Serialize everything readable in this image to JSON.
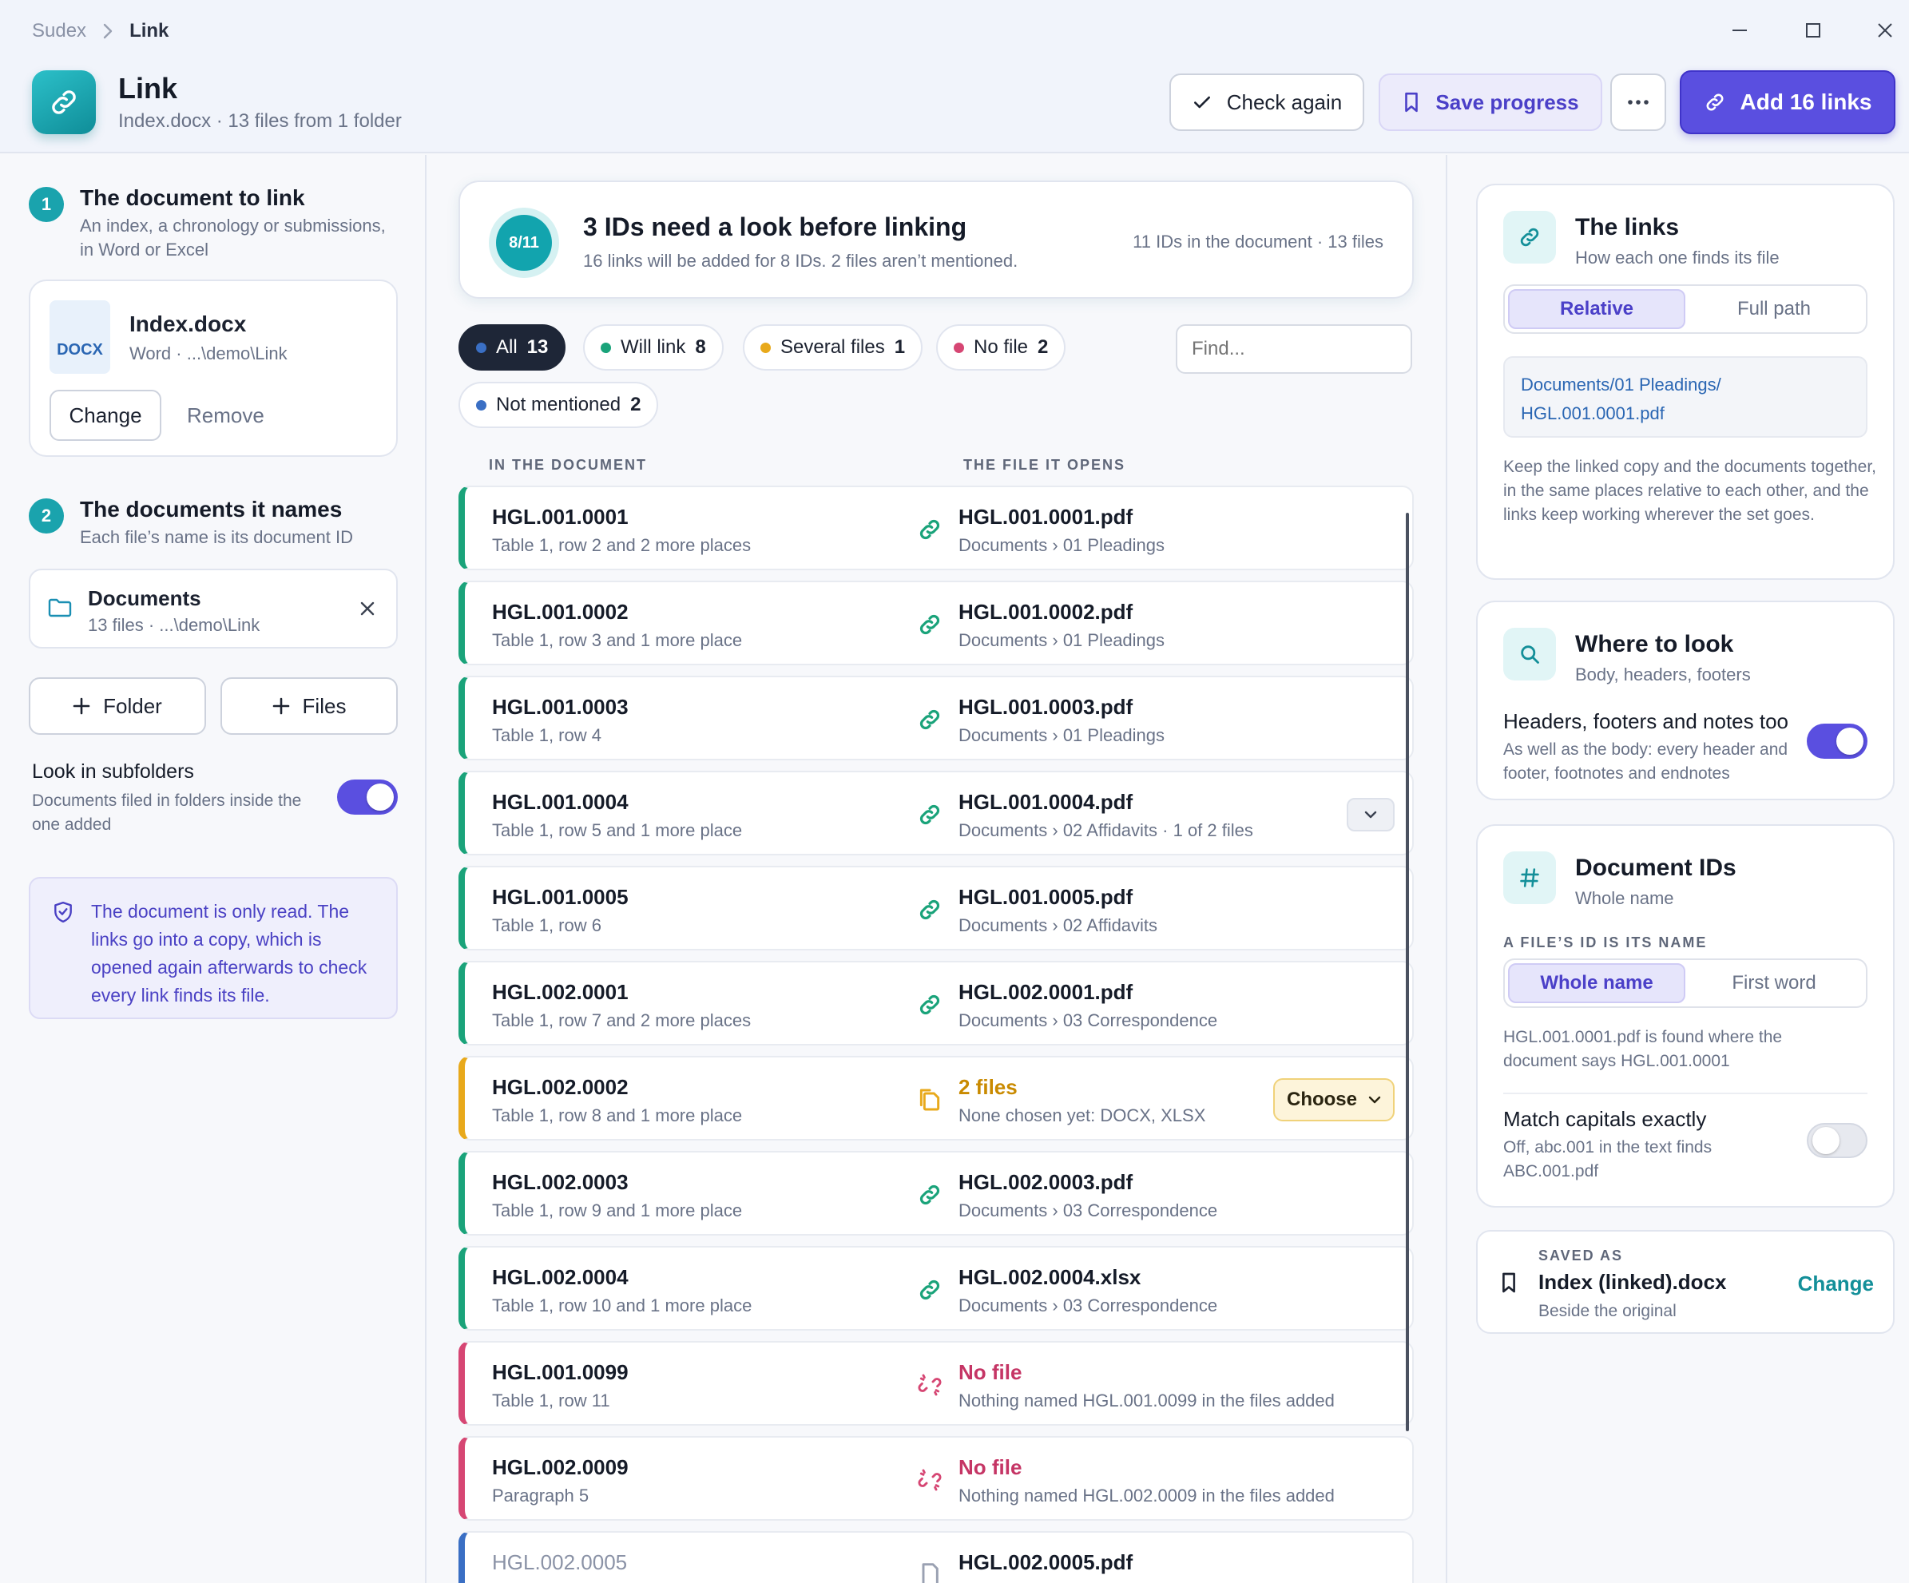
{
  "window": {
    "breadcrumb_root": "Sudex",
    "breadcrumb_current": "Link",
    "app_title": "Link",
    "app_subtitle": "Index.docx · 13 files from 1 folder"
  },
  "toolbar": {
    "check_again": "Check again",
    "save_progress": "Save progress",
    "add_links": "Add 16 links"
  },
  "left": {
    "step1": {
      "number": "1",
      "title": "The document to link",
      "subtitle": "An index, a chronology or submissions, in Word or Excel"
    },
    "document": {
      "type": "DOCX",
      "name": "Index.docx",
      "meta": "Word · ...\\demo\\Link",
      "change_label": "Change",
      "remove_label": "Remove"
    },
    "step2": {
      "number": "2",
      "title": "The documents it names",
      "subtitle": "Each file’s name is its document ID"
    },
    "folder": {
      "name": "Documents",
      "meta": "13 files · ...\\demo\\Link"
    },
    "add_folder": "Folder",
    "add_files": "Files",
    "subfolders": {
      "label": "Look in subfolders",
      "desc": "Documents filed in folders inside the one added",
      "on": true
    },
    "notice": "The document is only read. The links go into a copy, which is opened again afterwards to check every link finds its file."
  },
  "summary": {
    "progress": "8/11",
    "title": "3 IDs need a look before linking",
    "subtitle": "16 links will be added for 8 IDs. 2 files aren’t mentioned.",
    "stats": "11 IDs in the document · 13 files"
  },
  "filters": [
    {
      "label": "All",
      "count": "13",
      "dot": "#3a6fc4",
      "active": true
    },
    {
      "label": "Will link",
      "count": "8",
      "dot": "#1aa37a"
    },
    {
      "label": "Several files",
      "count": "1",
      "dot": "#e8a91b"
    },
    {
      "label": "No file",
      "count": "2",
      "dot": "#d64673"
    },
    {
      "label": "Not mentioned",
      "count": "2",
      "dot": "#3a6fc4"
    }
  ],
  "search": {
    "placeholder": "Find..."
  },
  "columns": {
    "left": "IN THE DOCUMENT",
    "right": "THE FILE IT OPENS"
  },
  "rows": [
    {
      "id": "HGL.001.0001",
      "loc": "Table 1, row 2 and 2 more places",
      "file": "HGL.001.0001.pdf",
      "path": "Documents › 01 Pleadings",
      "status": "link"
    },
    {
      "id": "HGL.001.0002",
      "loc": "Table 1, row 3 and 1 more place",
      "file": "HGL.001.0002.pdf",
      "path": "Documents › 01 Pleadings",
      "status": "link"
    },
    {
      "id": "HGL.001.0003",
      "loc": "Table 1, row 4",
      "file": "HGL.001.0003.pdf",
      "path": "Documents › 01 Pleadings",
      "status": "link"
    },
    {
      "id": "HGL.001.0004",
      "loc": "Table 1, row 5 and 1 more place",
      "file": "HGL.001.0004.pdf",
      "path": "Documents › 02 Affidavits · 1 of 2 files",
      "status": "link",
      "dropdown": true
    },
    {
      "id": "HGL.001.0005",
      "loc": "Table 1, row 6",
      "file": "HGL.001.0005.pdf",
      "path": "Documents › 02 Affidavits",
      "status": "link"
    },
    {
      "id": "HGL.002.0001",
      "loc": "Table 1, row 7 and 2 more places",
      "file": "HGL.002.0001.pdf",
      "path": "Documents › 03 Correspondence",
      "status": "link"
    },
    {
      "id": "HGL.002.0002",
      "loc": "Table 1, row 8 and 1 more place",
      "file": "2 files",
      "path": "None chosen yet: DOCX, XLSX",
      "status": "several",
      "choose": "Choose"
    },
    {
      "id": "HGL.002.0003",
      "loc": "Table 1, row 9 and 1 more place",
      "file": "HGL.002.0003.pdf",
      "path": "Documents › 03 Correspondence",
      "status": "link"
    },
    {
      "id": "HGL.002.0004",
      "loc": "Table 1, row 10 and 1 more place",
      "file": "HGL.002.0004.xlsx",
      "path": "Documents › 03 Correspondence",
      "status": "link"
    },
    {
      "id": "HGL.001.0099",
      "loc": "Table 1, row 11",
      "file": "No file",
      "path": "Nothing named HGL.001.0099 in the files added",
      "status": "nofile"
    },
    {
      "id": "HGL.002.0009",
      "loc": "Paragraph 5",
      "file": "No file",
      "path": "Nothing named HGL.002.0009 in the files added",
      "status": "nofile"
    },
    {
      "id": "HGL.002.0005",
      "loc": "",
      "file": "HGL.002.0005.pdf",
      "path": "",
      "status": "notmentioned"
    }
  ],
  "links_card": {
    "title": "The links",
    "subtitle": "How each one finds its file",
    "seg_on": "Relative",
    "seg_off": "Full path",
    "path_line1": "Documents/01 Pleadings/",
    "path_line2": "HGL.001.0001.pdf",
    "body": "Keep the linked copy and the documents together, in the same places relative to each other, and the links keep working wherever the set goes."
  },
  "look_card": {
    "title": "Where to look",
    "subtitle": "Body, headers, footers",
    "label": "Headers, footers and notes too",
    "desc": "As well as the body: every header and footer, footnotes and endnotes",
    "on": true
  },
  "ids_card": {
    "title": "Document IDs",
    "subtitle": "Whole name",
    "caption": "A FILE’S ID IS ITS NAME",
    "seg_on": "Whole name",
    "seg_off": "First word",
    "example": "HGL.001.0001.pdf is found where the document says HGL.001.0001",
    "match_label": "Match capitals exactly",
    "match_desc": "Off, abc.001 in the text finds ABC.001.pdf",
    "match_on": false
  },
  "saved_card": {
    "caption": "SAVED AS",
    "name": "Index (linked).docx",
    "sub": "Beside the original",
    "change": "Change"
  }
}
